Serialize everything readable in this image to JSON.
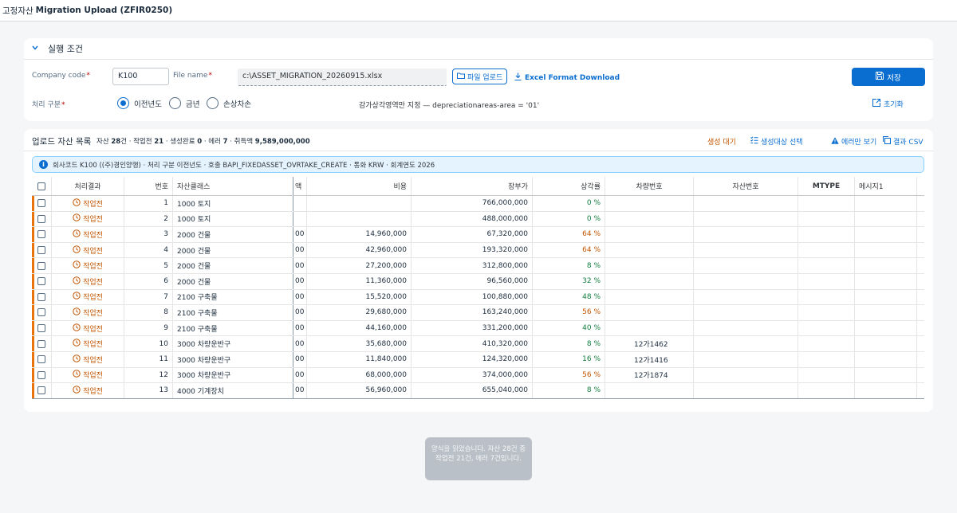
{
  "shell": {
    "app_name": "고정자산",
    "title": "Migration Upload (ZFIR0250)"
  },
  "conditions": {
    "panel_title": "실행 조건",
    "company_code_label": "Company code",
    "company_code_value": "K100",
    "file_name_label": "File name",
    "file_name_value": "c:\\ASSET_MIGRATION_20260915.xlsx",
    "upload_button": "파일 업로드",
    "excel_download": "Excel Format Download",
    "save_button": "저장",
    "process_type_label": "처리 구분",
    "process_options": [
      "이전년도",
      "금년",
      "손상차손"
    ],
    "selected_option": "이전년도",
    "depreciation_note": "감가상각영역만 지정 — depreciationareas-area = '01'",
    "reset_button": "초기화",
    "required_mark": "*"
  },
  "assets": {
    "title": "업로드 자산 목록",
    "stats": {
      "assets_label": "자산",
      "assets": "28",
      "assets_unit": "건 · 작업전",
      "pending": "21",
      "created_label": " · 생성완료",
      "created": "0",
      "error_label": " · 에러",
      "error": "7",
      "amount_label": " · 취득액",
      "amount": "9,589,000,000"
    },
    "pending_link": "생성 대기",
    "select_link": "생성대상 선택",
    "errors_only_link": "에러만 보기",
    "csv_link": "결과 CSV",
    "info_text": "회사코드 K100 ((주)경인양행) · 처리 구분 이전년도 · 호출 BAPI_FIXEDASSET_OVRTAKE_CREATE · 통화 KRW · 회계연도 2026",
    "columns": {
      "result": "처리결과",
      "no": "번호",
      "class": "자산클래스",
      "acq": "액",
      "cost": "비용",
      "book": "장부가",
      "rate": "상각률",
      "vehicle": "차량번호",
      "asset_no": "자산번호",
      "mtype": "MTYPE",
      "msg": "메시지1"
    },
    "rows": [
      {
        "status": "작업전",
        "no": "1",
        "class": "1000 토지",
        "acq": "",
        "cost": "",
        "book": "766,000,000",
        "rate": "0 %",
        "rate_color": "green",
        "vehicle": ""
      },
      {
        "status": "작업전",
        "no": "2",
        "class": "1000 토지",
        "acq": "",
        "cost": "",
        "book": "488,000,000",
        "rate": "0 %",
        "rate_color": "green",
        "vehicle": ""
      },
      {
        "status": "작업전",
        "no": "3",
        "class": "2000 건물",
        "acq": "00",
        "cost": "14,960,000",
        "book": "67,320,000",
        "rate": "64 %",
        "rate_color": "orange",
        "vehicle": ""
      },
      {
        "status": "작업전",
        "no": "4",
        "class": "2000 건물",
        "acq": "00",
        "cost": "42,960,000",
        "book": "193,320,000",
        "rate": "64 %",
        "rate_color": "orange",
        "vehicle": ""
      },
      {
        "status": "작업전",
        "no": "5",
        "class": "2000 건물",
        "acq": "00",
        "cost": "27,200,000",
        "book": "312,800,000",
        "rate": "8 %",
        "rate_color": "green",
        "vehicle": ""
      },
      {
        "status": "작업전",
        "no": "6",
        "class": "2000 건물",
        "acq": "00",
        "cost": "11,360,000",
        "book": "96,560,000",
        "rate": "32 %",
        "rate_color": "green",
        "vehicle": ""
      },
      {
        "status": "작업전",
        "no": "7",
        "class": "2100 구축물",
        "acq": "00",
        "cost": "15,520,000",
        "book": "100,880,000",
        "rate": "48 %",
        "rate_color": "green",
        "vehicle": ""
      },
      {
        "status": "작업전",
        "no": "8",
        "class": "2100 구축물",
        "acq": "00",
        "cost": "29,680,000",
        "book": "163,240,000",
        "rate": "56 %",
        "rate_color": "orange",
        "vehicle": ""
      },
      {
        "status": "작업전",
        "no": "9",
        "class": "2100 구축물",
        "acq": "00",
        "cost": "44,160,000",
        "book": "331,200,000",
        "rate": "40 %",
        "rate_color": "green",
        "vehicle": ""
      },
      {
        "status": "작업전",
        "no": "10",
        "class": "3000 차량운반구",
        "acq": "00",
        "cost": "35,680,000",
        "book": "410,320,000",
        "rate": "8 %",
        "rate_color": "green",
        "vehicle": "12가1462"
      },
      {
        "status": "작업전",
        "no": "11",
        "class": "3000 차량운반구",
        "acq": "00",
        "cost": "11,840,000",
        "book": "124,320,000",
        "rate": "16 %",
        "rate_color": "green",
        "vehicle": "12가1416"
      },
      {
        "status": "작업전",
        "no": "12",
        "class": "3000 차량운반구",
        "acq": "00",
        "cost": "68,000,000",
        "book": "374,000,000",
        "rate": "56 %",
        "rate_color": "orange",
        "vehicle": "12가1874"
      },
      {
        "status": "작업전",
        "no": "13",
        "class": "4000 기계장치",
        "acq": "00",
        "cost": "56,960,000",
        "book": "655,040,000",
        "rate": "8 %",
        "rate_color": "green",
        "vehicle": ""
      }
    ]
  },
  "toast": {
    "text": "양식을 읽었습니다. 자산 28건 중 작업전 21건, 에러 7건입니다."
  },
  "colors": {
    "accent": "#0a6ed1",
    "warning": "#e9730c",
    "positive": "#107e3e"
  }
}
